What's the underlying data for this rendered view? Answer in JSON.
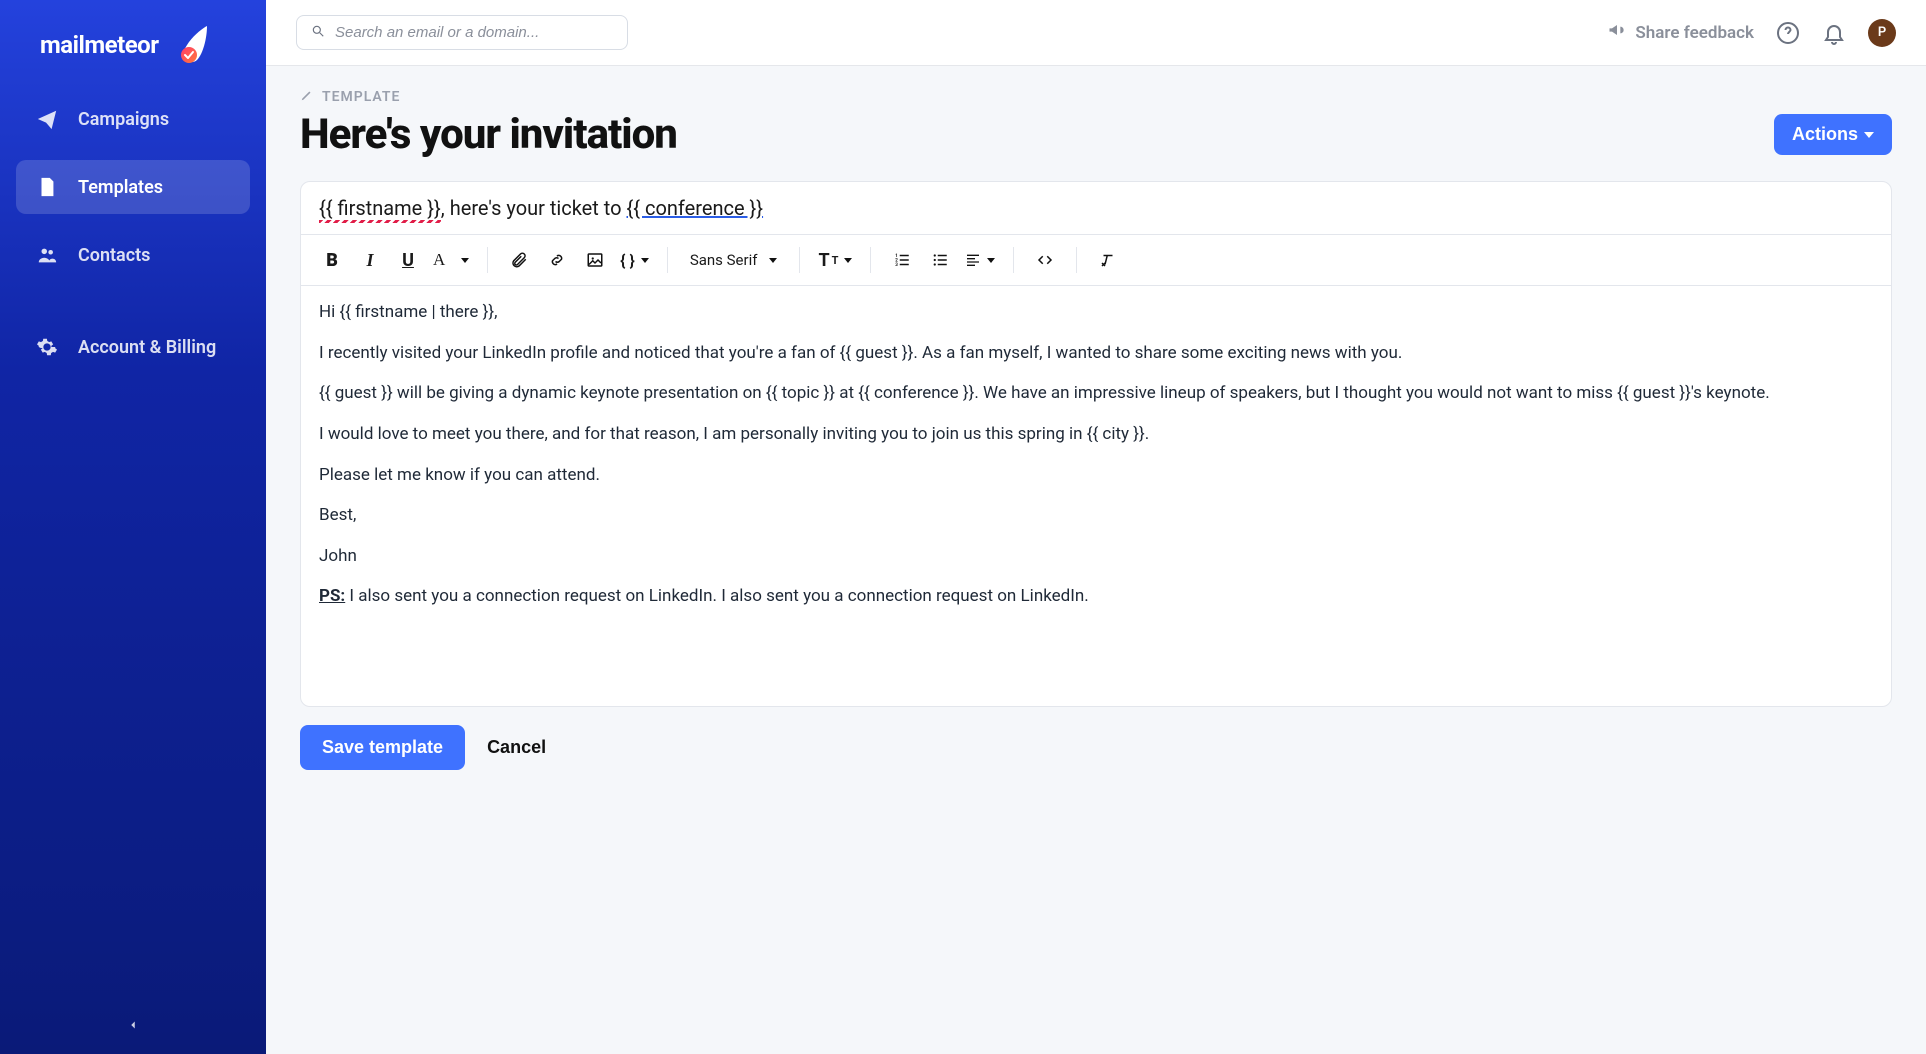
{
  "brand": {
    "name": "mailmeteor"
  },
  "sidebar": {
    "items": [
      {
        "label": "Campaigns"
      },
      {
        "label": "Templates"
      },
      {
        "label": "Contacts"
      },
      {
        "label": "Account & Billing"
      }
    ]
  },
  "topbar": {
    "search_placeholder": "Search an email or a domain...",
    "feedback_label": "Share feedback",
    "avatar_initial": "P"
  },
  "page": {
    "crumb": "TEMPLATE",
    "title": "Here's your invitation",
    "actions_label": "Actions"
  },
  "editor": {
    "subject_prefix": "{{ firstname }}",
    "subject_middle": ", here's your ticket to ",
    "subject_suffix": "{{ conference }}",
    "font_family": "Sans Serif",
    "body": {
      "p1": "Hi {{ firstname | there }},",
      "p2": "I recently visited your LinkedIn profile and noticed that you're a fan of {{ guest }}. As a fan myself, I wanted to share some exciting news with you.",
      "p3": "{{ guest }} will be giving a dynamic keynote presentation on {{ topic }} at {{ conference }}. We have an impressive lineup of speakers, but I thought you would not want to miss {{ guest }}'s keynote.",
      "p4": "I would love to meet you there, and for that reason, I am personally inviting you to join us this spring in {{ city }}.",
      "p5": "Please let me know if you can attend.",
      "p6": "Best,",
      "p7": "John",
      "p8_ps": "PS:",
      "p8_rest": " I also sent you a connection request on LinkedIn. I also sent you a connection request on LinkedIn."
    }
  },
  "footer": {
    "save_label": "Save template",
    "cancel_label": "Cancel"
  }
}
